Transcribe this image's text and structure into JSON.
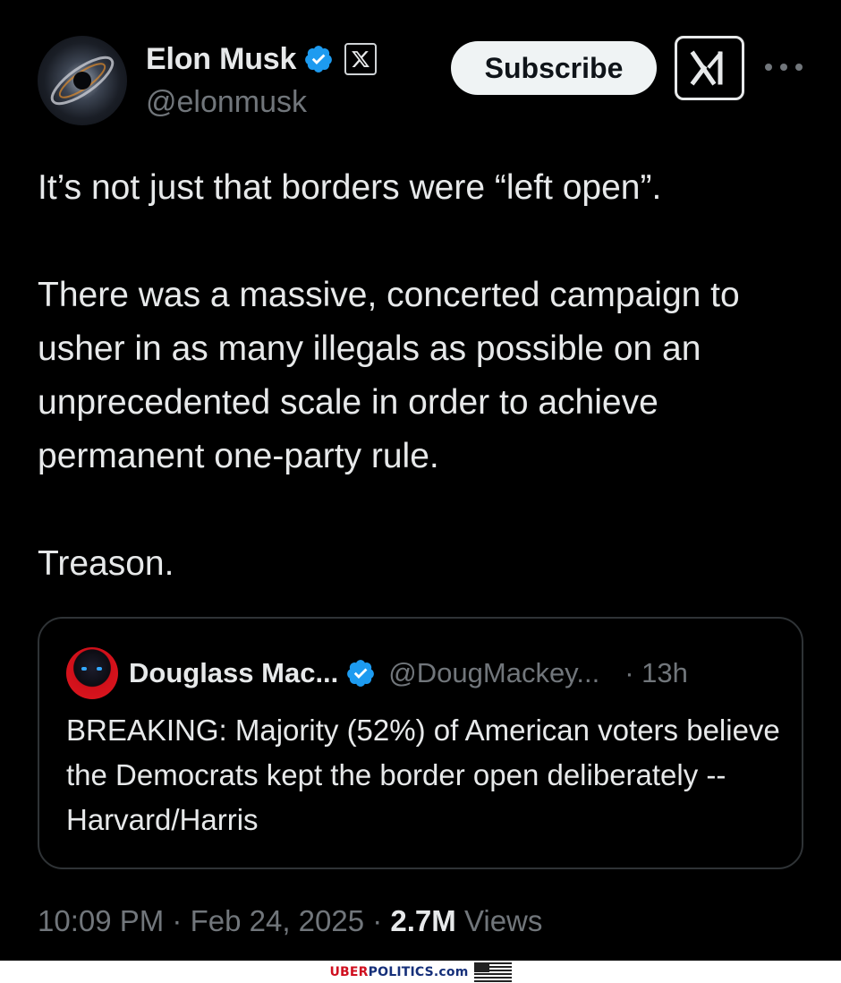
{
  "author": {
    "name": "Elon Musk",
    "handle": "@elonmusk"
  },
  "actions": {
    "subscribe_label": "Subscribe"
  },
  "tweet": {
    "paragraphs": [
      "It’s not just that borders were “left open”.",
      "There was a massive, concerted campaign to usher in as many illegals as possible on an unprecedented scale in order to achieve permanent one-party rule.",
      "Treason."
    ]
  },
  "quote": {
    "name": "Douglass Mac...",
    "handle": "@DougMackey...",
    "time": "· 13h",
    "text": "BREAKING: Majority (52%) of American voters believe the Democrats kept the border open deliberately -- Harvard/Harris"
  },
  "meta": {
    "time": "10:09 PM",
    "sep1": " · ",
    "date": "Feb 24, 2025",
    "sep2": " · ",
    "views_count": "2.7M",
    "views_label": " Views"
  },
  "watermark": {
    "part1": "UBER",
    "part2": "POLITICS.com"
  },
  "colors": {
    "background": "#000000",
    "text": "#e7e9ea",
    "secondary": "#71767b",
    "verified": "#1d9bf0",
    "border": "#2f3336"
  },
  "icons": [
    "verified-badge-icon",
    "x-logo-icon",
    "grok-icon",
    "more-options-icon",
    "us-flag-icon"
  ]
}
